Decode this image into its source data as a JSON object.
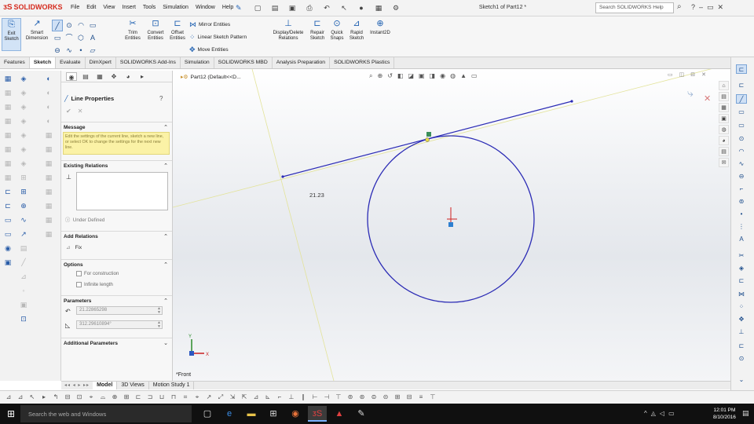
{
  "app": {
    "logo_prefix": "ᴣS",
    "logo_text": "SOLIDWORKS",
    "document_title": "Sketch1 of Part12 *",
    "search_placeholder": "Search SOLIDWORKS Help"
  },
  "menu": [
    "File",
    "Edit",
    "View",
    "Insert",
    "Tools",
    "Simulation",
    "Window",
    "Help"
  ],
  "command_manager": {
    "exit_sketch": "Exit Sketch",
    "smart_dimension": "Smart Dimension",
    "trim_entities": "Trim Entities",
    "convert_entities": "Convert Entities",
    "offset_entities": "Offset Entities",
    "mirror_entities": "Mirror Entities",
    "linear_sketch_pattern": "Linear Sketch Pattern",
    "move_entities": "Move Entities",
    "display_delete_relations": "Display/Delete Relations",
    "repair_sketch": "Repair Sketch",
    "quick_snaps": "Quick Snaps",
    "rapid_sketch": "Rapid Sketch",
    "instant2d": "Instant2D"
  },
  "tabs": [
    "Features",
    "Sketch",
    "Evaluate",
    "DimXpert",
    "SOLIDWORKS Add-Ins",
    "Simulation",
    "SOLIDWORKS MBD",
    "Analysis Preparation",
    "SOLIDWORKS Plastics"
  ],
  "active_tab": "Sketch",
  "property_manager": {
    "title": "Line Properties",
    "message_header": "Message",
    "message_text": "Edit the settings of the current line, sketch a new line, or select OK to change the settings for the next new line.",
    "existing_relations_header": "Existing Relations",
    "under_defined": "Under Defined",
    "add_relations_header": "Add Relations",
    "fix_label": "Fix",
    "options_header": "Options",
    "for_construction": "For construction",
    "infinite_length": "Infinite length",
    "parameters_header": "Parameters",
    "length_value": "21.22865298",
    "angle_value": "312.29610894°",
    "additional_parameters_header": "Additional Parameters"
  },
  "graphics": {
    "tree_root": "Part12  (Default<<D...",
    "dimension_text": "21.23",
    "view_label": "*Front"
  },
  "bottom_tabs": {
    "nav": "◂◂ ◂ ▸ ▸▸",
    "items": [
      "Model",
      "3D Views",
      "Motion Study 1"
    ],
    "active": "Model"
  },
  "taskbar": {
    "search_placeholder": "Search the web and Windows",
    "time": "12:01 PM",
    "date": "8/10/2016"
  },
  "colors": {
    "accent": "#1d5fb0",
    "sketch_line": "#2b2bb5",
    "construction_line": "#e3e39a",
    "message_bg": "#fbf2a6",
    "taskbar": "#101010"
  }
}
